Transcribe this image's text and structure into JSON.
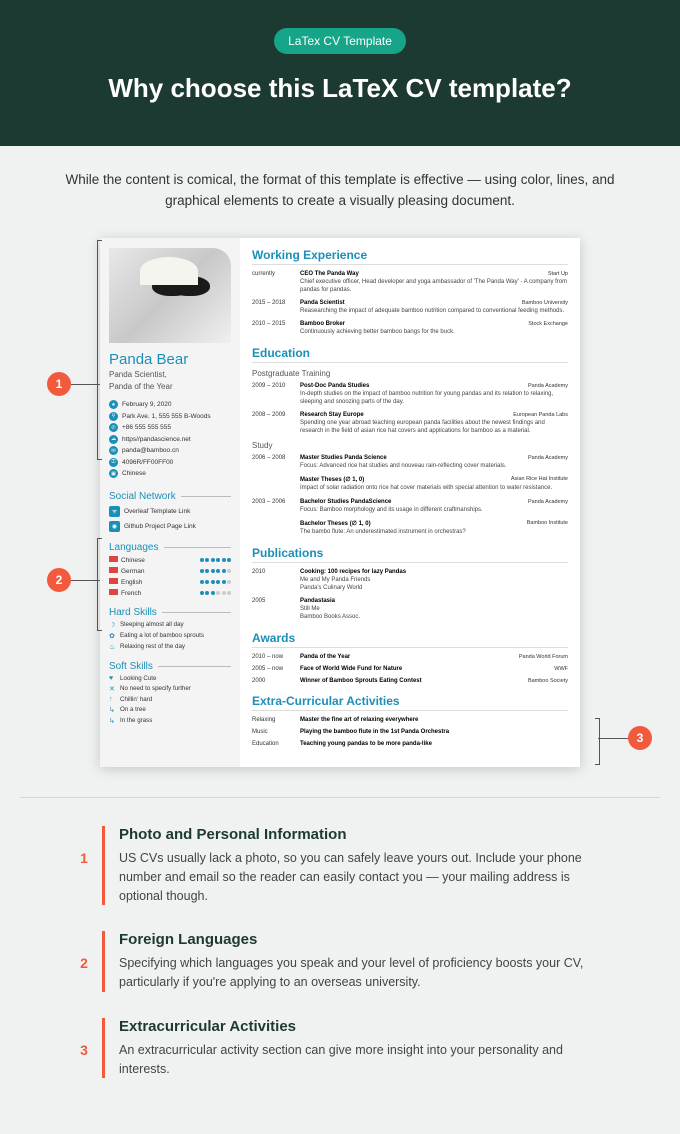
{
  "header": {
    "badge": "LaTex CV Template",
    "title": "Why choose this LaTeX CV template?"
  },
  "intro": "While the content is comical, the format of this template is effective — using color, lines, and graphical elements to create a visually pleasing document.",
  "cv": {
    "name": "Panda Bear",
    "subtitle1": "Panda Scientist,",
    "subtitle2": "Panda of the Year",
    "contacts": [
      {
        "icon": "★",
        "text": "February 9, 2020"
      },
      {
        "icon": "⚲",
        "text": "Park Ave. 1, 555 555 B-Woods"
      },
      {
        "icon": "✆",
        "text": "+86 555 555 555"
      },
      {
        "icon": "☁",
        "text": "https//pandascience.net"
      },
      {
        "icon": "✉",
        "text": "panda@bamboo.cn"
      },
      {
        "icon": "⚿",
        "text": "4096R/FF00FF00"
      },
      {
        "icon": "▣",
        "text": "Chinese"
      }
    ],
    "social_h": "Social Network",
    "social": [
      {
        "icon": "ᯤ",
        "text": "Overleaf Template Link"
      },
      {
        "icon": "◉",
        "text": "Github Project Page Link"
      }
    ],
    "lang_h": "Languages",
    "langs": [
      {
        "name": "Chinese",
        "filled": 6
      },
      {
        "name": "German",
        "filled": 5
      },
      {
        "name": "English",
        "filled": 5
      },
      {
        "name": "French",
        "filled": 3
      }
    ],
    "hard_h": "Hard Skills",
    "hard": [
      {
        "icon": "☽",
        "text": "Sleeping almost all day"
      },
      {
        "icon": "✿",
        "text": "Eating a lot of bamboo sprouts"
      },
      {
        "icon": "♨",
        "text": "Relaxing rest of the day"
      }
    ],
    "soft_h": "Soft Skills",
    "soft": [
      {
        "icon": "♥",
        "text": "Looking Cute"
      },
      {
        "icon": "✕",
        "text": "No need to specify further"
      },
      {
        "icon": "↑",
        "text": "Chillin' hard"
      },
      {
        "icon": "↳",
        "text": "On a tree"
      },
      {
        "icon": "↳",
        "text": "In the grass"
      }
    ],
    "work_h": "Working Experience",
    "work": [
      {
        "date": "currently",
        "title": "CEO The Panda Way",
        "org": "Start Up",
        "desc": "Chief executive officer, Head developer and yoga ambassador of 'The Panda Way' - A company from pandas for pandas."
      },
      {
        "date": "2015 – 2018",
        "title": "Panda Scientist",
        "org": "Bamboo University",
        "desc": "Reasearching the impact of adequate bamboo nutrition compared to conventional feeding methods."
      },
      {
        "date": "2010 – 2015",
        "title": "Bamboo Broker",
        "org": "Stock Exchange",
        "desc": "Continuously achieving better bamboo bangs for the buck."
      }
    ],
    "edu_h": "Education",
    "edu_sub1": "Postgraduate Training",
    "edu1": [
      {
        "date": "2009 – 2010",
        "title": "Post-Doc Panda Studies",
        "org": "Panda Academy",
        "desc": "In-depth studies on the impact of bamboo nutrition for young pandas and its relation to relaxing, sleeping and snoozing parts of the day."
      },
      {
        "date": "2008 – 2009",
        "title": "Research Stay Europe",
        "org": "European Panda Labs",
        "desc": "Spending one year abroad teaching european panda facilities about the newest findings and research in the field of asian rice hat covers and applications for bamboo as a material."
      }
    ],
    "edu_sub2": "Study",
    "edu2": [
      {
        "date": "2006 – 2008",
        "title": "Master Studies Panda Science",
        "org": "Panda Academy",
        "desc": "Focus: Advanced rice hat studies and nouveau rain-reflecting cover materials."
      },
      {
        "date": "",
        "title": "Master Theses (∅ 1, 0)",
        "org": "Asian Rice Hat Institute",
        "desc": "Impact of solar radiation onto rice hat cover materials with special attention to water resistance."
      },
      {
        "date": "2003 – 2006",
        "title": "Bachelor Studies PandaScience",
        "org": "Panda Academy",
        "desc": "Focus: Bamboo morphology and its usage in different craftmanships."
      },
      {
        "date": "",
        "title": "Bachelor Theses (∅ 1, 0)",
        "org": "Bamboo Institute",
        "desc": "The bambo flute: An underestimated instrument in orchestras?"
      }
    ],
    "pub_h": "Publications",
    "pubs": [
      {
        "date": "2010",
        "title": "Cooking: 100 recipes for lazy Pandas",
        "desc": "Me and My Panda Friends\nPanda's Culinary World"
      },
      {
        "date": "2005",
        "title": "Pandastasia",
        "desc": "Still Me\nBamboo Books Assoc."
      }
    ],
    "aw_h": "Awards",
    "awards": [
      {
        "date": "2010 – now",
        "title": "Panda of the Year",
        "org": "Panda World Forum"
      },
      {
        "date": "2005 – now",
        "title": "Face of World Wide Fund for Nature",
        "org": "WWF"
      },
      {
        "date": "2000",
        "title": "Winner of Bamboo Sprouts Eating Contest",
        "org": "Bamboo Society"
      }
    ],
    "ec_h": "Extra-Curricular Activities",
    "extra": [
      {
        "date": "Relaxing",
        "title": "Master the fine art of relaxing everywhere"
      },
      {
        "date": "Music",
        "title": "Playing the bamboo flute in the 1st Panda Orchestra"
      },
      {
        "date": "Education",
        "title": "Teaching young pandas to be more panda-like"
      }
    ]
  },
  "tips": [
    {
      "num": "1",
      "title": "Photo and Personal Information",
      "text": "US CVs usually lack a photo, so you can safely leave yours out. Include your phone number and email so the reader can easily contact you — your mailing address is optional though."
    },
    {
      "num": "2",
      "title": "Foreign Languages",
      "text": "Specifying which languages you speak and your level of proficiency boosts your CV, particularly if you're applying to an overseas university."
    },
    {
      "num": "3",
      "title": "Extracurricular Activities",
      "text": "An extracurricular activity section can give more insight into your personality and interests."
    }
  ]
}
